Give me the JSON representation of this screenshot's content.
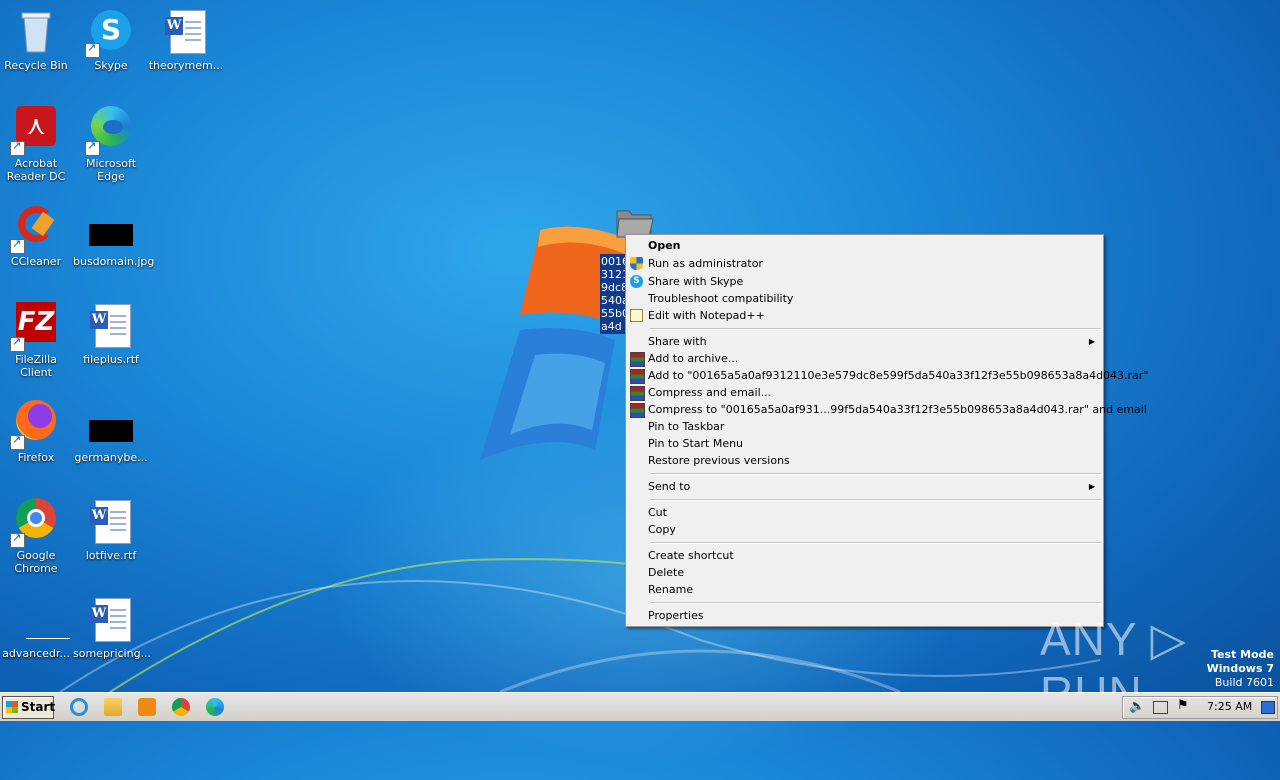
{
  "desktop_icons": [
    {
      "label": "Recycle Bin"
    },
    {
      "label": "Skype"
    },
    {
      "label": "theorymem..."
    },
    {
      "label": "Acrobat Reader DC"
    },
    {
      "label": "Microsoft Edge"
    },
    {
      "label": "CCleaner"
    },
    {
      "label": "busdomain.jpg"
    },
    {
      "label": "FileZilla Client"
    },
    {
      "label": "fileplus.rtf"
    },
    {
      "label": "Firefox"
    },
    {
      "label": "germanybe..."
    },
    {
      "label": "Google Chrome"
    },
    {
      "label": "lotfive.rtf"
    },
    {
      "label": "advancedr..."
    },
    {
      "label": "somepricing..."
    }
  ],
  "selected_file": {
    "label_lines": "0016\n3121\n9dc8\n540a\n55b0\na4d"
  },
  "context_menu": {
    "items": [
      {
        "label": "Open"
      },
      {
        "label": "Run as administrator"
      },
      {
        "label": "Share with Skype"
      },
      {
        "label": "Troubleshoot compatibility"
      },
      {
        "label": "Edit with Notepad++"
      },
      {
        "label": "Share with"
      },
      {
        "label": "Add to archive..."
      },
      {
        "label": "Add to \"00165a5a0af9312110e3e579dc8e599f5da540a33f12f3e55b098653a8a4d043.rar\""
      },
      {
        "label": "Compress and email..."
      },
      {
        "label": "Compress to \"00165a5a0af931...99f5da540a33f12f3e55b098653a8a4d043.rar\" and email"
      },
      {
        "label": "Pin to Taskbar"
      },
      {
        "label": "Pin to Start Menu"
      },
      {
        "label": "Restore previous versions"
      },
      {
        "label": "Send to"
      },
      {
        "label": "Cut"
      },
      {
        "label": "Copy"
      },
      {
        "label": "Create shortcut"
      },
      {
        "label": "Delete"
      },
      {
        "label": "Rename"
      },
      {
        "label": "Properties"
      }
    ]
  },
  "watermark": {
    "text": "ANY ▷ RUN"
  },
  "os_info": {
    "line1": "Test Mode",
    "line2": "Windows 7",
    "line3": "Build 7601"
  },
  "taskbar": {
    "start_label": "Start",
    "clock": "7:25 AM"
  },
  "colors": {
    "menu_bg": "#f0f0f0",
    "selection": "#103a8c",
    "desktop": "#1a85d6"
  }
}
